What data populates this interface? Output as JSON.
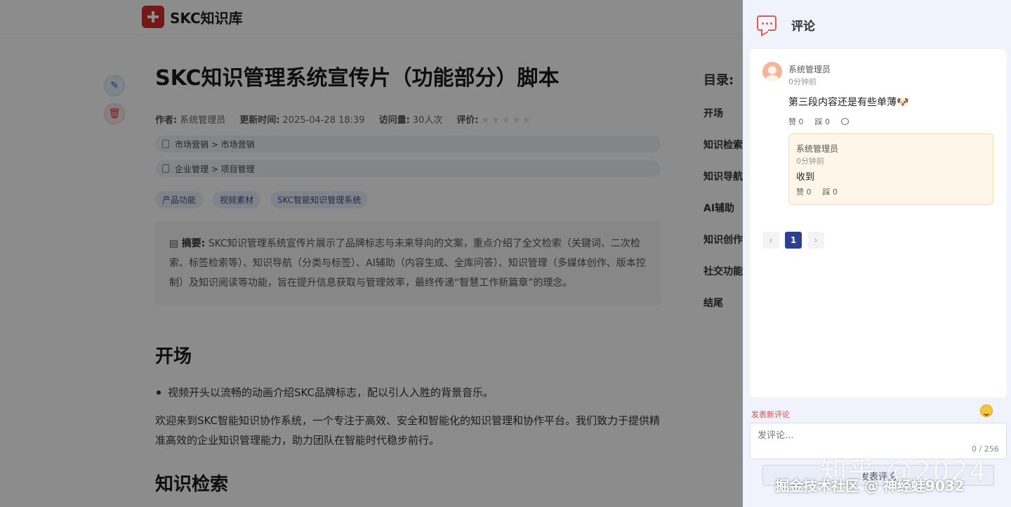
{
  "app": {
    "name": "SKC知识库"
  },
  "article": {
    "title": "SKC知识管理系统宣传片（功能部分）脚本",
    "meta": {
      "author_label": "作者:",
      "author": "系统管理员",
      "updated_label": "更新时间:",
      "updated": "2025-04-28 18:39",
      "views_label": "访问量:",
      "views": "30人次",
      "rating_label": "评价:",
      "rating_stars": "★★★★★"
    },
    "categories": [
      "市场营销 > 市场营销",
      "企业管理 > 项目管理"
    ],
    "tags": [
      "产品功能",
      "视频素材",
      "SKC智能知识管理系统"
    ],
    "summary_label": "摘要:",
    "summary": "SKC知识管理系统宣传片展示了品牌标志与未来导向的文案，重点介绍了全文检索（关键词、二次检索、标签检索等）、知识导航（分类与标签）、AI辅助（内容生成、全库问答）、知识管理（多媒体创作、版本控制）及知识阅读等功能，旨在提升信息获取与管理效率，最终传递“智慧工作新篇章”的理念。",
    "section1_title": "开场",
    "bullet1": "视频开头以流畅的动画介绍SKC品牌标志，配以引人入胜的背景音乐。",
    "para1": "欢迎来到SKC智能知识协作系统，一个专注于高效、安全和智能化的知识管理和协作平台。我们致力于提供精准高效的企业知识管理能力，助力团队在智能时代稳步前行。",
    "section2_title": "知识检索"
  },
  "toc": {
    "title": "目录:",
    "items": [
      "开场",
      "知识检索",
      "知识导航",
      "AI辅助",
      "知识创作",
      "社交功能",
      "结尾"
    ]
  },
  "comments": {
    "title": "评论",
    "items": [
      {
        "user": "系统管理员",
        "time": "0分钟前",
        "text": "第三段内容还是有些单薄🐶",
        "like_label": "赞 0",
        "dislike_label": "踩 0",
        "reply": {
          "user": "系统管理员",
          "time": "0分钟前",
          "text": "收到",
          "like_label": "赞 0",
          "dislike_label": "踩 0"
        }
      }
    ],
    "pagination": {
      "prev": "‹",
      "current": "1",
      "next": "›"
    },
    "new_comment_label": "发表新评论",
    "input_placeholder": "发评论...",
    "counter": "0 / 256",
    "submit_label": "发表评论"
  },
  "watermark": {
    "line1": "知乎 @2024",
    "line2": "掘金技术社区 @ 神经蛙9032"
  },
  "colors": {
    "accent_red": "#d65b55",
    "pager_active": "#2d3f8f",
    "reply_bg": "#fdf6e9"
  }
}
